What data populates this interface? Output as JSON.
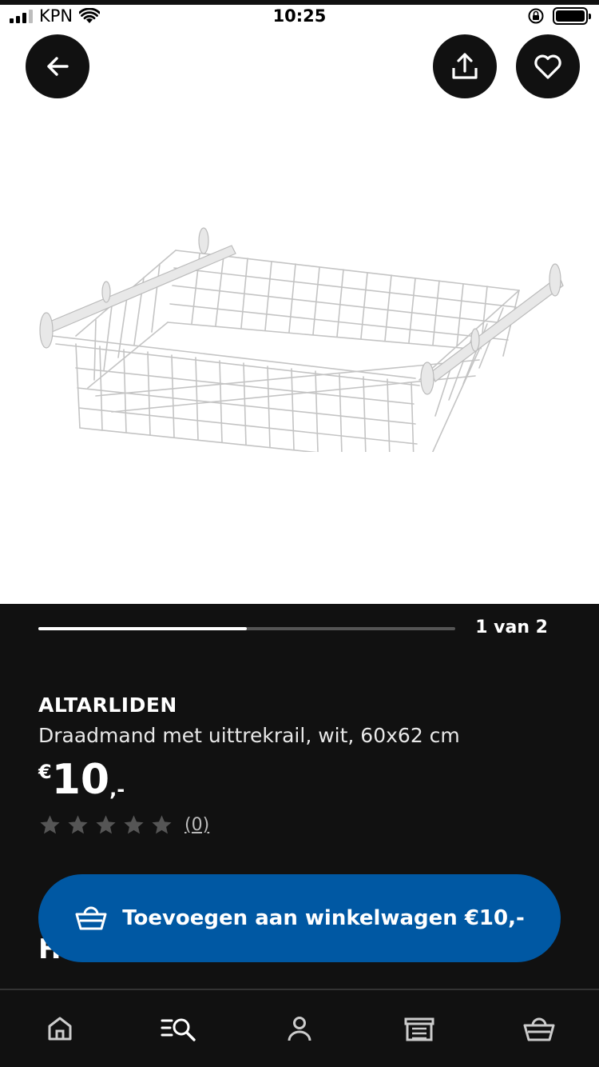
{
  "status_bar": {
    "carrier": "KPN",
    "time": "10:25"
  },
  "product": {
    "brand": "ALTARLIDEN",
    "description": "Draadmand met uittrekrail, wit, 60x62 cm",
    "price": {
      "currency": "€",
      "amount": "10",
      "suffix": ",-"
    },
    "rating": {
      "stars_filled": 0,
      "stars_total": 5,
      "review_count": "(0)"
    }
  },
  "gallery": {
    "indicator": "1 van 2",
    "progress": 0.5
  },
  "next_section_heading": "H",
  "actions": {
    "add_to_cart_label": "Toevoegen aan winkelwagen €10,-"
  },
  "icons": {
    "back": "arrow-left-icon",
    "share": "share-icon",
    "favorite": "heart-icon",
    "cart": "basket-icon",
    "nav": [
      "home-icon",
      "search-icon",
      "profile-icon",
      "store-icon",
      "basket-icon"
    ]
  },
  "colors": {
    "accent": "#0058a3",
    "background_dark": "#111111",
    "star_empty": "#555555"
  }
}
